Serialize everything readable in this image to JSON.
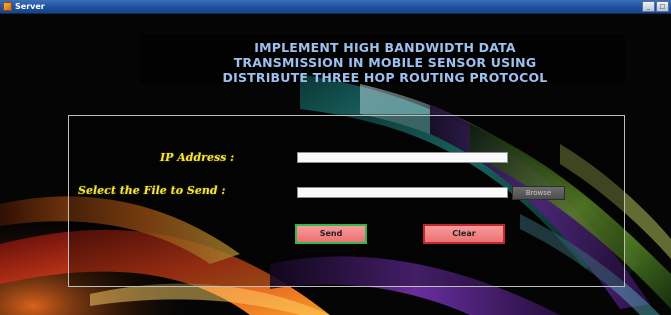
{
  "window": {
    "title": "Server",
    "controls": {
      "minimize": "_",
      "maximize": "□"
    }
  },
  "heading": {
    "line1": "IMPLEMENT HIGH BANDWIDTH DATA",
    "line2": "TRANSMISSION IN MOBILE SENSOR USING",
    "line3": "DISTRIBUTE THREE HOP ROUTING PROTOCOL"
  },
  "form": {
    "ip_label": "IP Address :",
    "ip_value": "",
    "file_label": "Select the File to Send :",
    "file_value": "",
    "browse_label": "Browse",
    "send_label": "Send",
    "clear_label": "Clear"
  },
  "colors": {
    "heading": "#9fc0ef",
    "label": "#f2e542",
    "button_fill": "#f08282",
    "send_border": "#2fb84b",
    "clear_border": "#c0282d",
    "titlebar": "#1d4f9c"
  },
  "icons": {
    "app": "app-window-icon"
  }
}
